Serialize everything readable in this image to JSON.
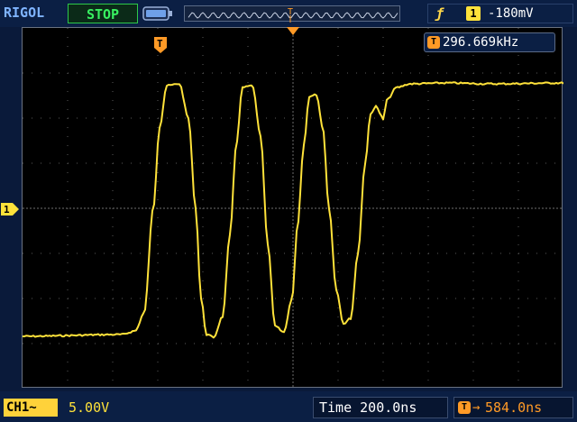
{
  "header": {
    "brand": "RIGOL",
    "run_status": "STOP",
    "memory_trigger_label": "T"
  },
  "trigger": {
    "edge_symbol": "ƒ",
    "source": "1",
    "level": "-180mV"
  },
  "measure": {
    "freq_icon": "T",
    "frequency": "296.669kHz"
  },
  "markers": {
    "trigger_label": "T",
    "channel_label": "1"
  },
  "footer": {
    "channel_label": "CH1",
    "coupling_symbol": "~",
    "channel_scale": "5.00V",
    "timebase": "Time 200.0ns",
    "trigger_offset_icon": "T",
    "trigger_offset_arrow": "→",
    "trigger_offset": "584.0ns"
  },
  "colors": {
    "trace": "#ffe23a",
    "trigger": "#ff9a26",
    "status": "#38f060",
    "background": "#000000"
  },
  "icons": {
    "battery": "battery-icon",
    "memory": "memory-depth-icon",
    "trigger_edge": "rising-edge-icon"
  }
}
